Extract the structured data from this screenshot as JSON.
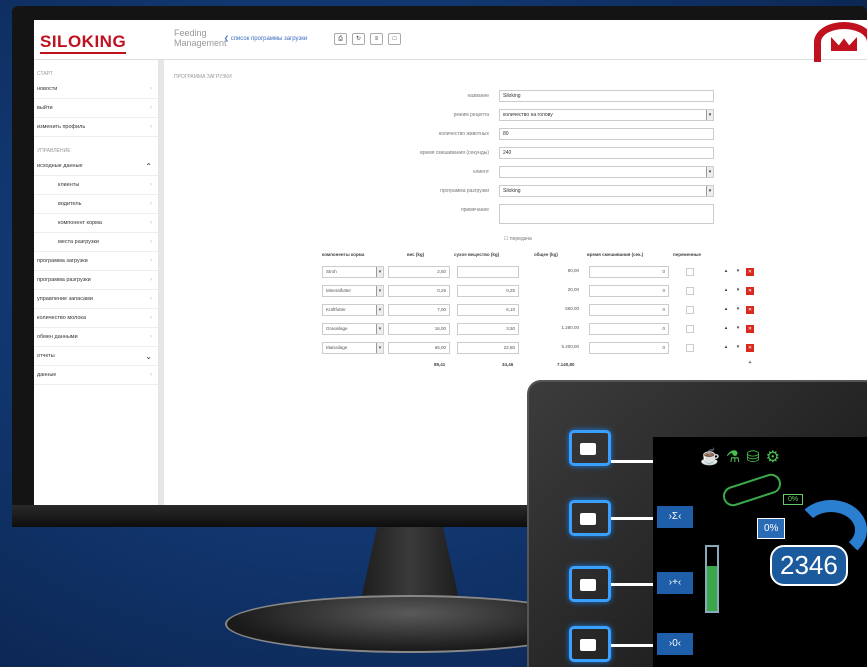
{
  "app": {
    "logo": "SILOKING",
    "name_line1": "Feeding",
    "name_line2": "Management",
    "back_link": "список программы загрузки",
    "toolbar_icons": [
      "print-icon",
      "refresh-icon",
      "list-icon",
      "copy-icon"
    ]
  },
  "sidebar": {
    "section_start": "СТАРТ",
    "section_manage": "УПРАВЛЕНИЕ",
    "items_top": [
      "новости",
      "выйти",
      "изменить профиль"
    ],
    "group_label": "исходные данные",
    "sub_items": [
      "клиенты",
      "водитель",
      "компонент корма",
      "места разгрузки"
    ],
    "items_bottom": [
      "программа загрузки",
      "программа разгрузки",
      "управление запасами",
      "количество молока",
      "обмен данными",
      "отчеты",
      "данные"
    ]
  },
  "form": {
    "title": "ПРОГРАММА ЗАГРУЗКИ",
    "fields": [
      {
        "label": "название",
        "value": "Siloking",
        "select": false
      },
      {
        "label": "режим рецепта",
        "value": "количество на голову",
        "select": true
      },
      {
        "label": "количество животных",
        "value": "80",
        "select": false
      },
      {
        "label": "время смешивания (секунды)",
        "value": "240",
        "select": false
      },
      {
        "label": "клиент",
        "value": "",
        "select": true
      },
      {
        "label": "программа разгрузки",
        "value": "Siloking",
        "select": true
      },
      {
        "label": "примечание",
        "value": "",
        "select": false
      }
    ],
    "checkbox_label": "передача"
  },
  "table": {
    "headers": [
      "компоненты корма",
      "вес (kg)",
      "сухое вещество (kg)",
      "общее (kg)",
      "время смешивания (сек.)",
      "переменные"
    ],
    "rows": [
      {
        "component": "Stroh",
        "weight": "2,50",
        "dry": "",
        "total": "80,00",
        "mix": "0"
      },
      {
        "component": "Mineralfutter",
        "weight": "0,25",
        "dry": "0,25",
        "total": "20,00",
        "mix": "0"
      },
      {
        "component": "Kraftfutter",
        "weight": "7,00",
        "dry": "6,10",
        "total": "560,00",
        "mix": "0"
      },
      {
        "component": "Grassilage",
        "weight": "16,00",
        "dry": "3,50",
        "total": "1.280,00",
        "mix": "0"
      },
      {
        "component": "Maissilage",
        "weight": "65,00",
        "dry": "22,80",
        "total": "5.200,00",
        "mix": "0"
      }
    ],
    "totals": {
      "weight": "89,41",
      "dry": "34,46",
      "total": "7.140,80"
    }
  },
  "device": {
    "percent": "0%",
    "outline_percent": "0%",
    "count": "2346",
    "button_labels": [
      "›Σ‹",
      "›+‹",
      "›0‹"
    ]
  }
}
